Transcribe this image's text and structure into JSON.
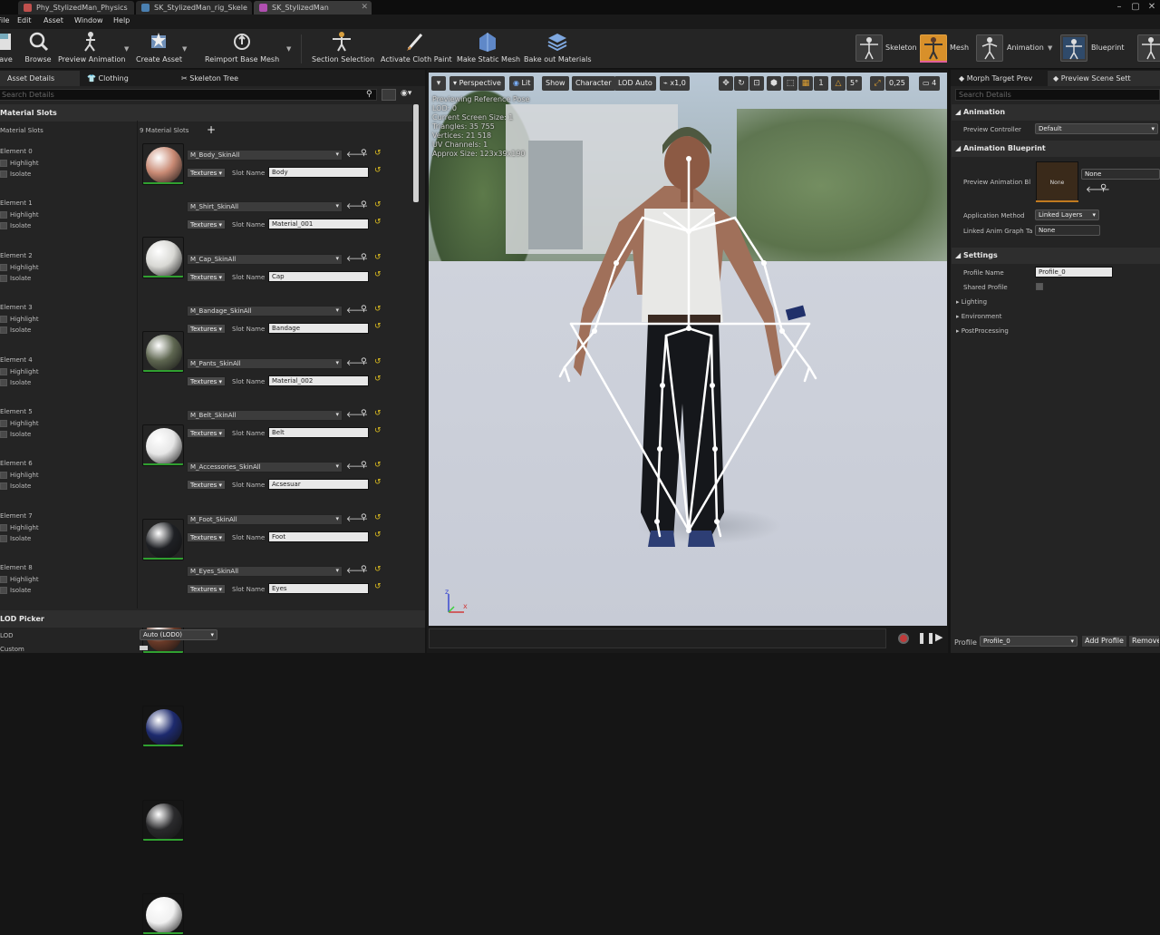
{
  "tabs": [
    {
      "label": "Phy_StylizedMan_Physics"
    },
    {
      "label": "SK_StylizedMan_rig_Skele"
    },
    {
      "label": "SK_StylizedMan"
    }
  ],
  "menu": [
    "File",
    "Edit",
    "Asset",
    "Window",
    "Help"
  ],
  "toolbar": {
    "save": "Save",
    "browse": "Browse",
    "preview_animation": "Preview Animation",
    "create_asset": "Create Asset",
    "reimport": "Reimport Base Mesh",
    "section_selection": "Section Selection",
    "activate_cloth": "Activate Cloth Paint",
    "make_static": "Make Static Mesh",
    "bake_out": "Bake out Materials"
  },
  "modes": {
    "skeleton": "Skeleton",
    "mesh": "Mesh",
    "animation": "Animation",
    "blueprint": "Blueprint"
  },
  "left_tabs": {
    "asset_details": "Asset Details",
    "clothing": "Clothing",
    "skeleton_tree": "Skeleton Tree"
  },
  "search_placeholder": "Search Details",
  "material_slots": {
    "section_title": "Material Slots",
    "row_label": "Material Slots",
    "count_label": "9 Material Slots",
    "highlight": "Highlight",
    "isolate": "Isolate",
    "textures": "Textures",
    "slot_name_label": "Slot Name",
    "elements": [
      {
        "label": "Element 0",
        "material": "M_Body_SkinAll",
        "slot": "Body",
        "color": "#c98a74"
      },
      {
        "label": "Element 1",
        "material": "M_Shirt_SkinAll",
        "slot": "Material_001",
        "color": "#d8d8d4"
      },
      {
        "label": "Element 2",
        "material": "M_Cap_SkinAll",
        "slot": "Cap",
        "color": "#5e6650"
      },
      {
        "label": "Element 3",
        "material": "M_Bandage_SkinAll",
        "slot": "Bandage",
        "color": "#e6e6e6"
      },
      {
        "label": "Element 4",
        "material": "M_Pants_SkinAll",
        "slot": "Material_002",
        "color": "#1e2024"
      },
      {
        "label": "Element 5",
        "material": "M_Belt_SkinAll",
        "slot": "Belt",
        "color": "#6a3a28"
      },
      {
        "label": "Element 6",
        "material": "M_Accessories_SkinAll",
        "slot": "Acsesuar",
        "color": "#1d2a6e"
      },
      {
        "label": "Element 7",
        "material": "M_Foot_SkinAll",
        "slot": "Foot",
        "color": "#2a2a2c"
      },
      {
        "label": "Element 8",
        "material": "M_Eyes_SkinAll",
        "slot": "Eyes",
        "color": "#f0f0f0"
      }
    ]
  },
  "lod_picker": {
    "title": "LOD Picker",
    "lod_label": "LOD",
    "lod_value": "Auto (LOD0)",
    "custom_label": "Custom"
  },
  "viewport": {
    "perspective": "Perspective",
    "lit": "Lit",
    "show": "Show",
    "character": "Character",
    "lod_auto": "LOD Auto",
    "speed": "x1,0",
    "angle": "5°",
    "scale": "0,25",
    "cam_speed": "4",
    "info": [
      "Previewing Reference Pose",
      "LOD: 0",
      "Current Screen Size: 1",
      "Triangles: 35 755",
      "Vertices: 21 518",
      "UV Channels: 1",
      "Approx Size: 123x39x190"
    ],
    "axis_z": "z",
    "axis_x": "x"
  },
  "right_tabs": {
    "morph": "Morph Target Prev",
    "scene": "Preview Scene Sett"
  },
  "right": {
    "search_placeholder": "Search Details",
    "animation_section": "Animation",
    "preview_controller_label": "Preview Controller",
    "preview_controller_value": "Default",
    "anim_bp_section": "Animation Blueprint",
    "preview_anim_bp_label": "Preview Animation Bl",
    "none_thumb": "None",
    "none_value": "None",
    "application_method_label": "Application Method",
    "application_method_value": "Linked Layers",
    "linked_anim_label": "Linked Anim Graph Ta",
    "linked_anim_value": "None",
    "settings_section": "Settings",
    "profile_name_label": "Profile Name",
    "profile_name_value": "Profile_0",
    "shared_profile_label": "Shared Profile",
    "lighting": "Lighting",
    "environment": "Environment",
    "postprocessing": "PostProcessing",
    "profile_label": "Profile",
    "profile_value": "Profile_0",
    "add_profile": "Add Profile",
    "remove": "Remove"
  }
}
